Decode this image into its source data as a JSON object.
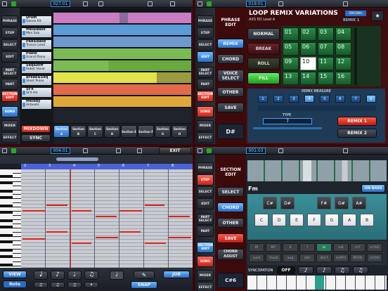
{
  "q1": {
    "time": "027:01",
    "sidebar": [
      "PHRASE",
      "STEP",
      "SELECT",
      "EDIT",
      "PART SELECT",
      "PART",
      "SECTION EDIT",
      "SONG",
      "MIXER",
      "EFFECT"
    ],
    "tracks": [
      {
        "name": "Drum",
        "sub": "Dance Kit"
      },
      {
        "name": "Mel&Bass",
        "sub": "Mini Sub"
      },
      {
        "name": "Pad&Base",
        "sub": "Trance Lead"
      },
      {
        "name": "Piano",
        "sub": "Grand Piano"
      },
      {
        "name": "Seq&Riff",
        "sub": "Robot Vocal"
      },
      {
        "name": "Break&Seq",
        "sub": "Short Pulse"
      },
      {
        "name": "SFX",
        "sub": "SFX Hit"
      },
      {
        "name": "Melody",
        "sub": "Airbeats"
      }
    ],
    "lane_colors": [
      "#c97cc0",
      "#5a9bd8",
      "#6f9ad0",
      "#7cbb54",
      "#c6c53a",
      "#e06a4a",
      "#e0b03a",
      "#8aa0c0"
    ],
    "mixdown": "MIXDOWN",
    "sync": "SYNC",
    "sections": [
      "Section A",
      "Section B",
      "Section C",
      "Section D",
      "Section E",
      "Section F",
      "Section G",
      "Section H"
    ]
  },
  "q2": {
    "time": "019:01",
    "title": "LOOP REMIX VARIATIONS",
    "sub": "AXS ED Lead A",
    "original": "ORIGINAL",
    "remix_label": "REMIX 1",
    "side_top": "PHRASE EDIT",
    "side": [
      "REMIX",
      "CHORD",
      "VOICE SELECT",
      "OTHER",
      "SAVE"
    ],
    "key": "D#",
    "modes": [
      "NORMAL",
      "BREAK",
      "ROLL",
      "FILL"
    ],
    "cells": [
      "01",
      "02",
      "03",
      "04",
      "05",
      "06",
      "07",
      "08",
      "09",
      "10",
      "11",
      "12",
      "13",
      "14",
      "15",
      "16"
    ],
    "measure_label": "REMIX MEASURE",
    "measures": [
      "1",
      "2",
      "3",
      "4",
      "5",
      "6",
      "7",
      "8"
    ],
    "type_label": "TYPE",
    "type_value": "7",
    "remix1": "REMIX 1",
    "remix2": "REMIX 2"
  },
  "q3": {
    "time": "004:01",
    "exit": "EXIT",
    "bars": [
      "2",
      "3",
      "4",
      "5",
      "6",
      "7",
      "8"
    ],
    "view": "VIEW",
    "view_value": "Note",
    "snap": "SNAP",
    "job": "JOB"
  },
  "q4": {
    "time": "001:03",
    "side_top": "SECTION EDIT",
    "side": [
      "SELECT",
      "CHORD",
      "OTHER",
      "SAVE",
      "CHORD ASSIST"
    ],
    "key": "C#6",
    "chord": "Fm",
    "on_bass": "ON BASS",
    "sharps": [
      "C#",
      "D#",
      "F#",
      "G#",
      "A#"
    ],
    "naturals": [
      "C",
      "D",
      "E",
      "F",
      "G",
      "A",
      "B"
    ],
    "types": [
      "M",
      "M7",
      "6",
      "7",
      "m",
      "m6",
      "m7",
      "m7b5",
      "sus4",
      "7sus4",
      "aug",
      "dim",
      "dim7",
      "m(M7)",
      "M7(9)",
      "m7(9)"
    ],
    "syncopation": "SYNCOPATION",
    "sync_value": "OFF"
  }
}
